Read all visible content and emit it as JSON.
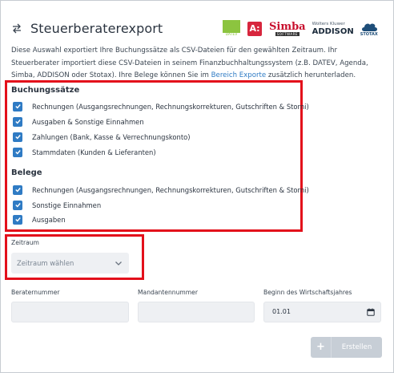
{
  "header": {
    "title": "Steuerberaterexport",
    "icon": "swap-arrows-icon"
  },
  "logos": {
    "datev": "DATEV",
    "agenda": "A:",
    "simba_name": "Simba",
    "simba_sub": "SOFTWARE",
    "addison_top": "Wolters Kluwer",
    "addison_name": "ADDISON",
    "stotax": "STOTAX"
  },
  "description": {
    "text_before_link": "Diese Auswahl exportiert Ihre Buchungssätze als CSV-Dateien für den gewählten Zeitraum. Ihr Steuerberater importiert diese CSV-Dateien in seinem Finanzbuchhaltungssystem (z.B. DATEV, Agenda, Simba, ADDISON oder Stotax). Ihre Belege können Sie im ",
    "link_text": "Bereich Exporte",
    "text_after_link": " zusätzlich herunterladen."
  },
  "buchungssaetze": {
    "title": "Buchungssätze",
    "items": [
      {
        "label": "Rechnungen (Ausgangsrechnungen, Rechnungskorrekturen, Gutschriften & Storni)",
        "checked": true
      },
      {
        "label": "Ausgaben & Sonstige Einnahmen",
        "checked": true
      },
      {
        "label": "Zahlungen (Bank, Kasse & Verrechnungskonto)",
        "checked": true
      },
      {
        "label": "Stammdaten (Kunden & Lieferanten)",
        "checked": true
      }
    ]
  },
  "belege": {
    "title": "Belege",
    "items": [
      {
        "label": "Rechnungen (Ausgangsrechnungen, Rechnungskorrekturen, Gutschriften & Storni)",
        "checked": true
      },
      {
        "label": "Sonstige Einnahmen",
        "checked": true
      },
      {
        "label": "Ausgaben",
        "checked": true
      }
    ]
  },
  "zeitraum": {
    "label": "Zeitraum",
    "placeholder": "Zeitraum wählen"
  },
  "fields": {
    "beraternummer_label": "Beraternummer",
    "beraternummer_value": "",
    "mandantennummer_label": "Mandantennummer",
    "mandantennummer_value": "",
    "wirtschaftsjahr_label": "Beginn des Wirtschaftsjahres",
    "wirtschaftsjahr_value": "01.01"
  },
  "actions": {
    "create_label": "Erstellen",
    "create_icon": "plus-icon"
  },
  "colors": {
    "accent": "#2f7bc4",
    "highlight": "#e3101b",
    "disabled_button": "#c7ced6"
  }
}
